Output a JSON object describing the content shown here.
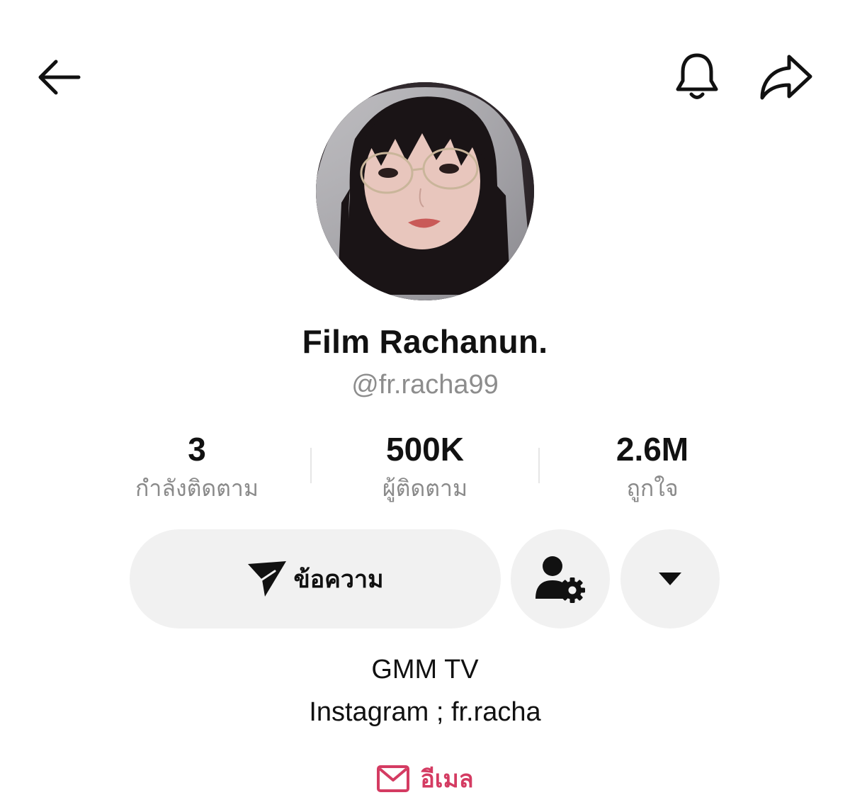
{
  "header": {
    "back_icon": "arrow-left-icon",
    "bell_icon": "bell-icon",
    "share_icon": "share-arrow-icon"
  },
  "profile": {
    "display_name": "Film Rachanun.",
    "username": "@fr.racha99"
  },
  "stats": [
    {
      "value": "3",
      "label": "กำลังติดตาม"
    },
    {
      "value": "500K",
      "label": "ผู้ติดตาม"
    },
    {
      "value": "2.6M",
      "label": "ถูกใจ"
    }
  ],
  "actions": {
    "message_label": "ข้อความ",
    "message_icon": "send-icon",
    "profile_settings_icon": "user-gear-icon",
    "more_icon": "caret-down-icon"
  },
  "bio": {
    "line1": "GMM TV",
    "line2": "Instagram ; fr.racha"
  },
  "email": {
    "label": "อีเมล",
    "icon": "mail-icon"
  },
  "colors": {
    "accent": "#d43b62",
    "muted": "#8a8a8a",
    "button_bg": "#f1f1f1"
  }
}
